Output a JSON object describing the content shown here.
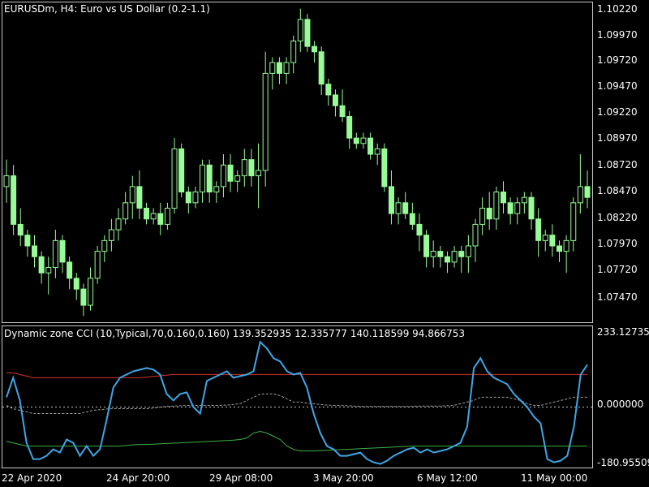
{
  "chart": {
    "symbol_title": "EURUSDm, H4:  Euro vs US Dollar (0.2-1.1)",
    "price_axis": [
      "1.10220",
      "1.09970",
      "1.09720",
      "1.09470",
      "1.09220",
      "1.08970",
      "1.08720",
      "1.08470",
      "1.08220",
      "1.07970",
      "1.07720",
      "1.07470"
    ],
    "time_axis": [
      "22 Apr 2020",
      "24 Apr 20:00",
      "29 Apr 08:00",
      "3 May 20:00",
      "6 May 12:00",
      "11 May 00:00"
    ],
    "candle_color": "#98fb98"
  },
  "indicator": {
    "title": "Dynamic zone CCI (10,Typical,70,0.160,0.160) 139.352935 12.335777 140.118599 94.866753",
    "axis_labels": [
      "233.127352",
      "0.000000",
      "-180.95509"
    ],
    "cci_color": "#3ea6e6",
    "upper_color": "#d93030",
    "lower_color": "#3cb043",
    "mid_color": "#a0a0a0"
  },
  "chart_data": [
    {
      "type": "candlestick",
      "title": "EURUSDm, H4:  Euro vs US Dollar (0.2-1.1)",
      "ylim": [
        1.0735,
        1.103
      ],
      "ohlc": [
        [
          1.086,
          1.0885,
          1.0845,
          1.087
        ],
        [
          1.087,
          1.088,
          1.0815,
          1.0825
        ],
        [
          1.0825,
          1.084,
          1.0805,
          1.0815
        ],
        [
          1.0815,
          1.082,
          1.0795,
          1.0805
        ],
        [
          1.0805,
          1.0815,
          1.0785,
          1.0795
        ],
        [
          1.0795,
          1.08,
          1.077,
          1.078
        ],
        [
          1.078,
          1.0795,
          1.076,
          1.0785
        ],
        [
          1.0785,
          1.082,
          1.0775,
          1.081
        ],
        [
          1.081,
          1.0815,
          1.078,
          1.079
        ],
        [
          1.079,
          1.0795,
          1.0765,
          1.0775
        ],
        [
          1.0775,
          1.078,
          1.0755,
          1.0765
        ],
        [
          1.0765,
          1.077,
          1.074,
          1.075
        ],
        [
          1.075,
          1.0785,
          1.0745,
          1.0775
        ],
        [
          1.0775,
          1.0805,
          1.077,
          1.08
        ],
        [
          1.08,
          1.0815,
          1.079,
          1.081
        ],
        [
          1.081,
          1.083,
          1.08,
          1.082
        ],
        [
          1.082,
          1.084,
          1.081,
          1.083
        ],
        [
          1.083,
          1.0855,
          1.0825,
          1.0845
        ],
        [
          1.0845,
          1.087,
          1.083,
          1.086
        ],
        [
          1.086,
          1.0875,
          1.083,
          1.084
        ],
        [
          1.084,
          1.0845,
          1.0825,
          1.083
        ],
        [
          1.083,
          1.084,
          1.0825,
          1.0835
        ],
        [
          1.0835,
          1.0845,
          1.0815,
          1.0825
        ],
        [
          1.0825,
          1.0845,
          1.082,
          1.084
        ],
        [
          1.084,
          1.0905,
          1.0835,
          1.0895
        ],
        [
          1.0895,
          1.09,
          1.085,
          1.0855
        ],
        [
          1.0855,
          1.086,
          1.0835,
          1.0845
        ],
        [
          1.0845,
          1.086,
          1.084,
          1.0855
        ],
        [
          1.0855,
          1.0885,
          1.0845,
          1.088
        ],
        [
          1.088,
          1.0885,
          1.0845,
          1.0855
        ],
        [
          1.0855,
          1.0865,
          1.0845,
          1.086
        ],
        [
          1.086,
          1.089,
          1.085,
          1.088
        ],
        [
          1.088,
          1.089,
          1.0855,
          1.0865
        ],
        [
          1.0865,
          1.0875,
          1.0855,
          1.087
        ],
        [
          1.087,
          1.0895,
          1.086,
          1.0885
        ],
        [
          1.0885,
          1.0895,
          1.086,
          1.087
        ],
        [
          1.087,
          1.09,
          1.084,
          1.0875
        ],
        [
          1.0875,
          1.0985,
          1.086,
          1.0965
        ],
        [
          1.0965,
          1.098,
          1.095,
          1.0975
        ],
        [
          1.0975,
          1.098,
          1.0955,
          1.0965
        ],
        [
          1.0965,
          1.098,
          1.0955,
          1.0975
        ],
        [
          1.0975,
          1.1,
          1.0965,
          1.0995
        ],
        [
          1.0995,
          1.1025,
          1.0985,
          1.1015
        ],
        [
          1.1015,
          1.102,
          1.0985,
          1.099
        ],
        [
          1.099,
          1.0995,
          1.0975,
          1.0985
        ],
        [
          1.0985,
          1.099,
          1.0945,
          1.0955
        ],
        [
          1.0955,
          1.096,
          1.0935,
          1.0945
        ],
        [
          1.0945,
          1.095,
          1.0925,
          1.0935
        ],
        [
          1.0935,
          1.095,
          1.092,
          1.0925
        ],
        [
          1.0925,
          1.093,
          1.0895,
          1.0905
        ],
        [
          1.0905,
          1.091,
          1.0895,
          1.09
        ],
        [
          1.09,
          1.091,
          1.0895,
          1.0905
        ],
        [
          1.0905,
          1.091,
          1.0885,
          1.089
        ],
        [
          1.089,
          1.09,
          1.088,
          1.0895
        ],
        [
          1.0895,
          1.09,
          1.0855,
          1.086
        ],
        [
          1.086,
          1.0875,
          1.0825,
          1.0835
        ],
        [
          1.0835,
          1.085,
          1.0825,
          1.0845
        ],
        [
          1.0845,
          1.0855,
          1.083,
          1.0835
        ],
        [
          1.0835,
          1.0845,
          1.082,
          1.0825
        ],
        [
          1.0825,
          1.0835,
          1.08,
          1.0815
        ],
        [
          1.0815,
          1.082,
          1.0785,
          1.0795
        ],
        [
          1.0795,
          1.081,
          1.0785,
          1.08
        ],
        [
          1.08,
          1.0805,
          1.0785,
          1.0795
        ],
        [
          1.0795,
          1.08,
          1.078,
          1.079
        ],
        [
          1.079,
          1.0805,
          1.0785,
          1.08
        ],
        [
          1.08,
          1.0805,
          1.078,
          1.0795
        ],
        [
          1.0795,
          1.0815,
          1.078,
          1.0805
        ],
        [
          1.0805,
          1.083,
          1.079,
          1.0825
        ],
        [
          1.0825,
          1.085,
          1.0815,
          1.084
        ],
        [
          1.084,
          1.0855,
          1.082,
          1.083
        ],
        [
          1.083,
          1.086,
          1.082,
          1.0855
        ],
        [
          1.0855,
          1.0865,
          1.0835,
          1.0845
        ],
        [
          1.0845,
          1.085,
          1.0825,
          1.0835
        ],
        [
          1.0835,
          1.085,
          1.0825,
          1.0845
        ],
        [
          1.0845,
          1.0855,
          1.0835,
          1.085
        ],
        [
          1.085,
          1.0855,
          1.082,
          1.083
        ],
        [
          1.083,
          1.084,
          1.0795,
          1.081
        ],
        [
          1.081,
          1.082,
          1.08,
          1.0815
        ],
        [
          1.0815,
          1.0825,
          1.0795,
          1.0805
        ],
        [
          1.0805,
          1.081,
          1.079,
          1.08
        ],
        [
          1.08,
          1.0815,
          1.078,
          1.081
        ],
        [
          1.081,
          1.085,
          1.08,
          1.0845
        ],
        [
          1.0845,
          1.089,
          1.0835,
          1.086
        ],
        [
          1.086,
          1.0875,
          1.084,
          1.085
        ]
      ]
    },
    {
      "type": "line",
      "title": "Dynamic zone CCI (10,Typical,70,0.160,0.160) 139.352935 12.335777 140.118599 94.866753",
      "ylim": [
        -180.95509,
        233.127352
      ],
      "series": [
        {
          "values": [
            30,
            90,
            20,
            -110,
            -160,
            -160,
            -150,
            -130,
            -140,
            -100,
            -110,
            -150,
            -120,
            -150,
            -130,
            -40,
            60,
            90,
            100,
            110,
            115,
            120,
            115,
            100,
            40,
            20,
            40,
            45,
            0,
            -20,
            80,
            90,
            100,
            110,
            90,
            95,
            100,
            110,
            200,
            180,
            150,
            140,
            110,
            100,
            105,
            60,
            -20,
            -80,
            -120,
            -130,
            -150,
            -150,
            -145,
            -140,
            -160,
            -170,
            -175,
            -165,
            -150,
            -140,
            -130,
            -125,
            -140,
            -130,
            -140,
            -135,
            -130,
            -120,
            -110,
            -60,
            120,
            150,
            110,
            90,
            80,
            70,
            40,
            20,
            0,
            -30,
            -50,
            -160,
            -170,
            -165,
            -150,
            -60,
            100,
            130
          ]
        },
        {
          "values": [
            105,
            105,
            100,
            95,
            90,
            90,
            90,
            90,
            90,
            90,
            90,
            90,
            90,
            90,
            90,
            90,
            90,
            90,
            90,
            90,
            90,
            92,
            94,
            96,
            98,
            100,
            100,
            100,
            100,
            100,
            100,
            100,
            100,
            100,
            100,
            100,
            100,
            100,
            100,
            100,
            100,
            100,
            100,
            100,
            100,
            100,
            100,
            100,
            100,
            100,
            100,
            100,
            100,
            100,
            100,
            100,
            100,
            100,
            100,
            100,
            100,
            100,
            100,
            100,
            100,
            100,
            100,
            100,
            100,
            100,
            100,
            100,
            100,
            100,
            100,
            100,
            100,
            100,
            100,
            100,
            100,
            100,
            100,
            100,
            100,
            100,
            100,
            100
          ]
        },
        {
          "values": [
            -105,
            -110,
            -115,
            -120,
            -120,
            -120,
            -120,
            -120,
            -120,
            -120,
            -120,
            -120,
            -120,
            -120,
            -120,
            -120,
            -120,
            -120,
            -118,
            -116,
            -115,
            -115,
            -114,
            -113,
            -112,
            -111,
            -110,
            -109,
            -108,
            -107,
            -106,
            -105,
            -104,
            -103,
            -102,
            -100,
            -95,
            -80,
            -75,
            -80,
            -90,
            -100,
            -120,
            -130,
            -135,
            -135,
            -135,
            -134,
            -133,
            -132,
            -131,
            -130,
            -129,
            -128,
            -127,
            -126,
            -125,
            -124,
            -123,
            -122,
            -121,
            -120,
            -120,
            -120,
            -120,
            -120,
            -120,
            -120,
            -120,
            -120,
            -120,
            -120,
            -120,
            -120,
            -120,
            -120,
            -120,
            -120,
            -120,
            -120,
            -120,
            -120,
            -120,
            -120,
            -120,
            -120,
            -120,
            -120
          ]
        },
        {
          "values": [
            5,
            -5,
            -10,
            -15,
            -20,
            -20,
            -20,
            -20,
            -20,
            -20,
            -20,
            -20,
            -15,
            -10,
            -8,
            -6,
            -5,
            -5,
            -5,
            -5,
            -5,
            -5,
            -3,
            0,
            2,
            3,
            4,
            5,
            5,
            5,
            5,
            5,
            5,
            6,
            8,
            10,
            20,
            30,
            40,
            40,
            40,
            35,
            25,
            15,
            15,
            12,
            10,
            8,
            6,
            5,
            5,
            4,
            3,
            2,
            2,
            2,
            2,
            2,
            2,
            2,
            2,
            2,
            3,
            3,
            3,
            3,
            4,
            5,
            10,
            15,
            20,
            30,
            30,
            30,
            30,
            30,
            25,
            20,
            10,
            5,
            5,
            10,
            15,
            20,
            25,
            30,
            30,
            30
          ]
        }
      ]
    }
  ]
}
